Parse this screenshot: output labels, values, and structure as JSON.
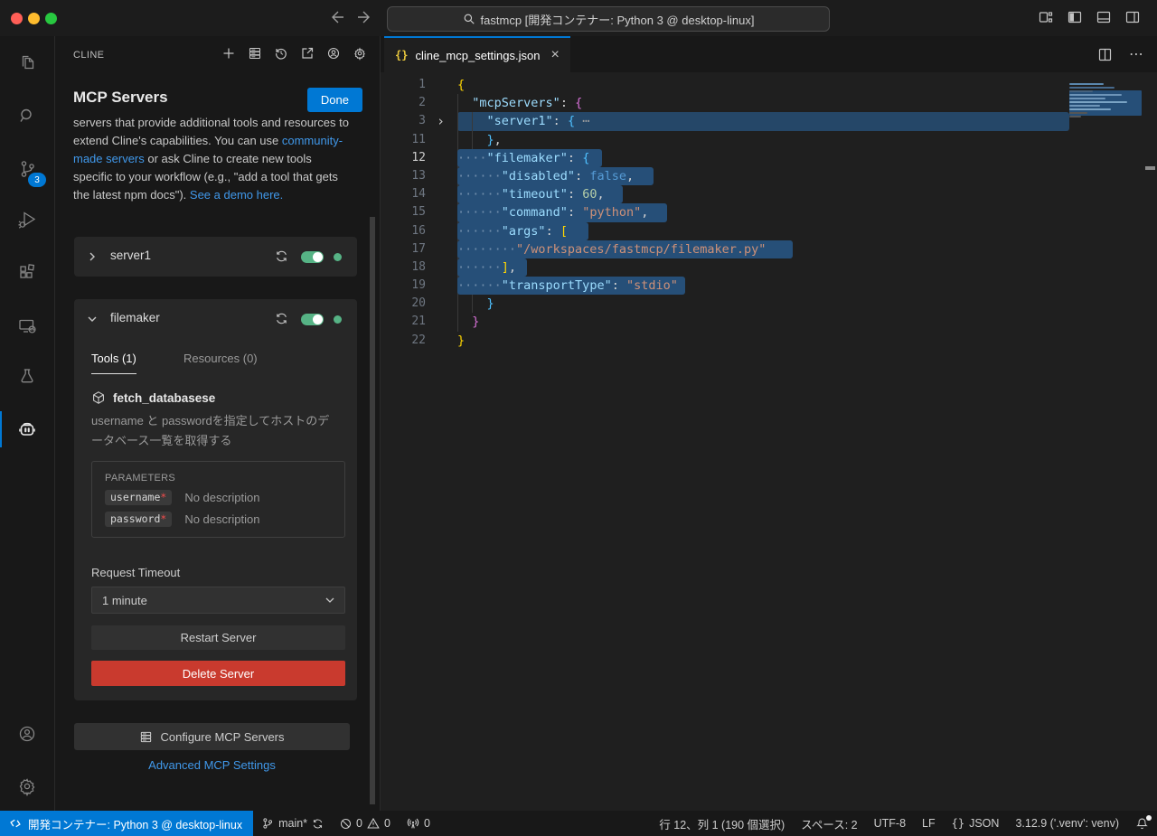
{
  "icons": {
    "close": "×",
    "more": "⋯",
    "fold_collapsed": "›",
    "json_braces": "{}"
  },
  "titlebar": {
    "search_text": "fastmcp [開発コンテナー: Python 3 @ desktop-linux]"
  },
  "activity_bar": {
    "scm_badge": "3"
  },
  "sidebar": {
    "panel_title": "CLINE",
    "heading": "MCP Servers",
    "done_label": "Done",
    "intro_pre": "servers that provide additional tools and resources to extend Cline's capabilities. You can use ",
    "intro_link1": "community-made servers",
    "intro_mid": " or ask Cline to create new tools specific to your workflow (e.g., \"add a tool that gets the latest npm docs\"). ",
    "intro_link2": "See a demo here.",
    "server1": {
      "name": "server1"
    },
    "filemaker": {
      "name": "filemaker",
      "tab_tools": "Tools (1)",
      "tab_resources": "Resources (0)",
      "tool_name": "fetch_databasese",
      "tool_desc": "username と passwordを指定してホストのデータベース一覧を取得する",
      "parameters_label": "PARAMETERS",
      "parameters": [
        {
          "name": "username",
          "required": "*",
          "desc": "No description"
        },
        {
          "name": "password",
          "required": "*",
          "desc": "No description"
        }
      ],
      "timeout_label": "Request Timeout",
      "timeout_value": "1 minute",
      "restart_label": "Restart Server",
      "delete_label": "Delete Server"
    },
    "configure_label": "Configure MCP Servers",
    "advanced_label": "Advanced MCP Settings"
  },
  "editor": {
    "tab_title": "cline_mcp_settings.json",
    "lines": [
      {
        "num": "1",
        "guides": 0,
        "tokens": [
          [
            "{",
            "b1"
          ]
        ]
      },
      {
        "num": "2",
        "guides": 1,
        "tokens": [
          [
            "  ",
            "p"
          ],
          [
            "\"mcpServers\"",
            "k"
          ],
          [
            ": ",
            "p"
          ],
          [
            "{",
            "b2"
          ]
        ]
      },
      {
        "num": "3",
        "guides": 2,
        "fold": true,
        "fullsel": true,
        "tokens": [
          [
            "    ",
            "p"
          ],
          [
            "\"server1\"",
            "k"
          ],
          [
            ": ",
            "p"
          ],
          [
            "{",
            "b3"
          ],
          [
            " ⋯",
            "fd"
          ]
        ]
      },
      {
        "num": "11",
        "guides": 2,
        "tokens": [
          [
            "    ",
            "p"
          ],
          [
            "}",
            "b3"
          ],
          [
            ",",
            "p"
          ]
        ]
      },
      {
        "num": "12",
        "guides": 2,
        "active": true,
        "sel": true,
        "pad": 14,
        "tokens": [
          [
            "····",
            "ws"
          ],
          [
            "\"filemaker\"",
            "k"
          ],
          [
            ": ",
            "p"
          ],
          [
            "{",
            "b3"
          ]
        ]
      },
      {
        "num": "13",
        "guides": 3,
        "sel": true,
        "pad": 22,
        "tokens": [
          [
            "······",
            "ws"
          ],
          [
            "\"disabled\"",
            "k"
          ],
          [
            ": ",
            "p"
          ],
          [
            "false",
            "kw"
          ],
          [
            ",",
            "p"
          ]
        ]
      },
      {
        "num": "14",
        "guides": 3,
        "sel": true,
        "pad": 20,
        "tokens": [
          [
            "······",
            "ws"
          ],
          [
            "\"timeout\"",
            "k"
          ],
          [
            ": ",
            "p"
          ],
          [
            "60",
            "n"
          ],
          [
            ",",
            "p"
          ]
        ]
      },
      {
        "num": "15",
        "guides": 3,
        "sel": true,
        "pad": 21,
        "tokens": [
          [
            "······",
            "ws"
          ],
          [
            "\"command\"",
            "k"
          ],
          [
            ": ",
            "p"
          ],
          [
            "\"python\"",
            "s"
          ],
          [
            ",",
            "p"
          ]
        ]
      },
      {
        "num": "16",
        "guides": 3,
        "sel": true,
        "pad": 23,
        "tokens": [
          [
            "······",
            "ws"
          ],
          [
            "\"args\"",
            "k"
          ],
          [
            ": ",
            "p"
          ],
          [
            "[",
            "b1"
          ]
        ]
      },
      {
        "num": "17",
        "guides": 4,
        "sel": true,
        "pad": 30,
        "tokens": [
          [
            "········",
            "ws"
          ],
          [
            "\"/workspaces/fastmcp/filemaker.py\"",
            "s"
          ]
        ]
      },
      {
        "num": "18",
        "guides": 3,
        "sel": true,
        "pad": 12,
        "tokens": [
          [
            "······",
            "ws"
          ],
          [
            "]",
            "b1"
          ],
          [
            ",",
            "p"
          ]
        ]
      },
      {
        "num": "19",
        "guides": 3,
        "sel": true,
        "pad": 8,
        "tokens": [
          [
            "······",
            "ws"
          ],
          [
            "\"transportType\"",
            "k"
          ],
          [
            ": ",
            "p"
          ],
          [
            "\"stdio\"",
            "s"
          ]
        ]
      },
      {
        "num": "20",
        "guides": 2,
        "tokens": [
          [
            "    ",
            "p"
          ],
          [
            "}",
            "b3"
          ]
        ]
      },
      {
        "num": "21",
        "guides": 1,
        "tokens": [
          [
            "  ",
            "p"
          ],
          [
            "}",
            "b2"
          ]
        ]
      },
      {
        "num": "22",
        "guides": 0,
        "tokens": [
          [
            "}",
            "b1"
          ]
        ]
      }
    ]
  },
  "status_bar": {
    "remote": "開発コンテナー: Python 3 @ desktop-linux",
    "branch": "main*",
    "errors": "0",
    "warnings": "0",
    "ports": "0",
    "cursor": "行 12、列 1 (190 個選択)",
    "indent": "スペース: 2",
    "encoding": "UTF-8",
    "eol": "LF",
    "lang_glyph": "{}",
    "language": "JSON",
    "interpreter": "3.12.9 ('.venv': venv)"
  }
}
